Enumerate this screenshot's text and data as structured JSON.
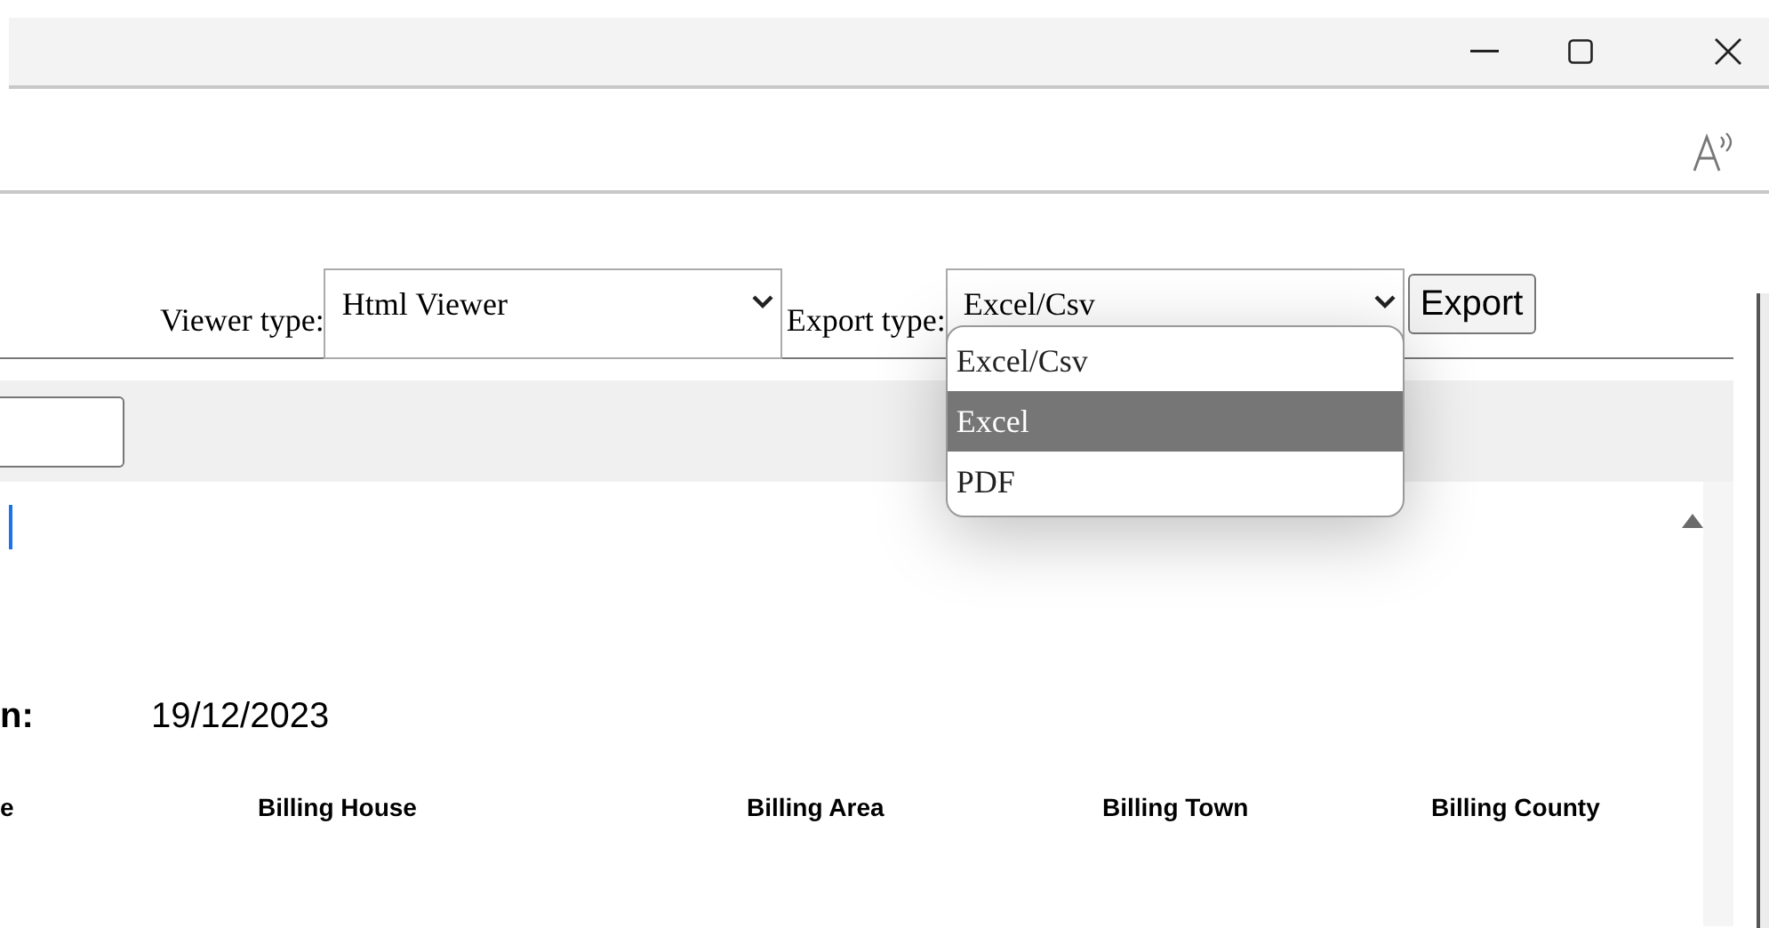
{
  "toolbar": {
    "viewer_type": {
      "label": "Viewer type:",
      "value": "Html Viewer"
    },
    "export_type": {
      "label": "Export type:",
      "value": "Excel/Csv",
      "expanded": true
    },
    "export_button": "Export"
  },
  "export_options": [
    {
      "label": "Excel/Csv",
      "selected": false
    },
    {
      "label": "Excel",
      "selected": true
    },
    {
      "label": "PDF",
      "selected": false
    }
  ],
  "report": {
    "date_label": "n:",
    "date": "19/12/2023",
    "columns": [
      "e",
      "Billing House",
      "Billing Area",
      "Billing Town",
      "Billing County"
    ]
  }
}
